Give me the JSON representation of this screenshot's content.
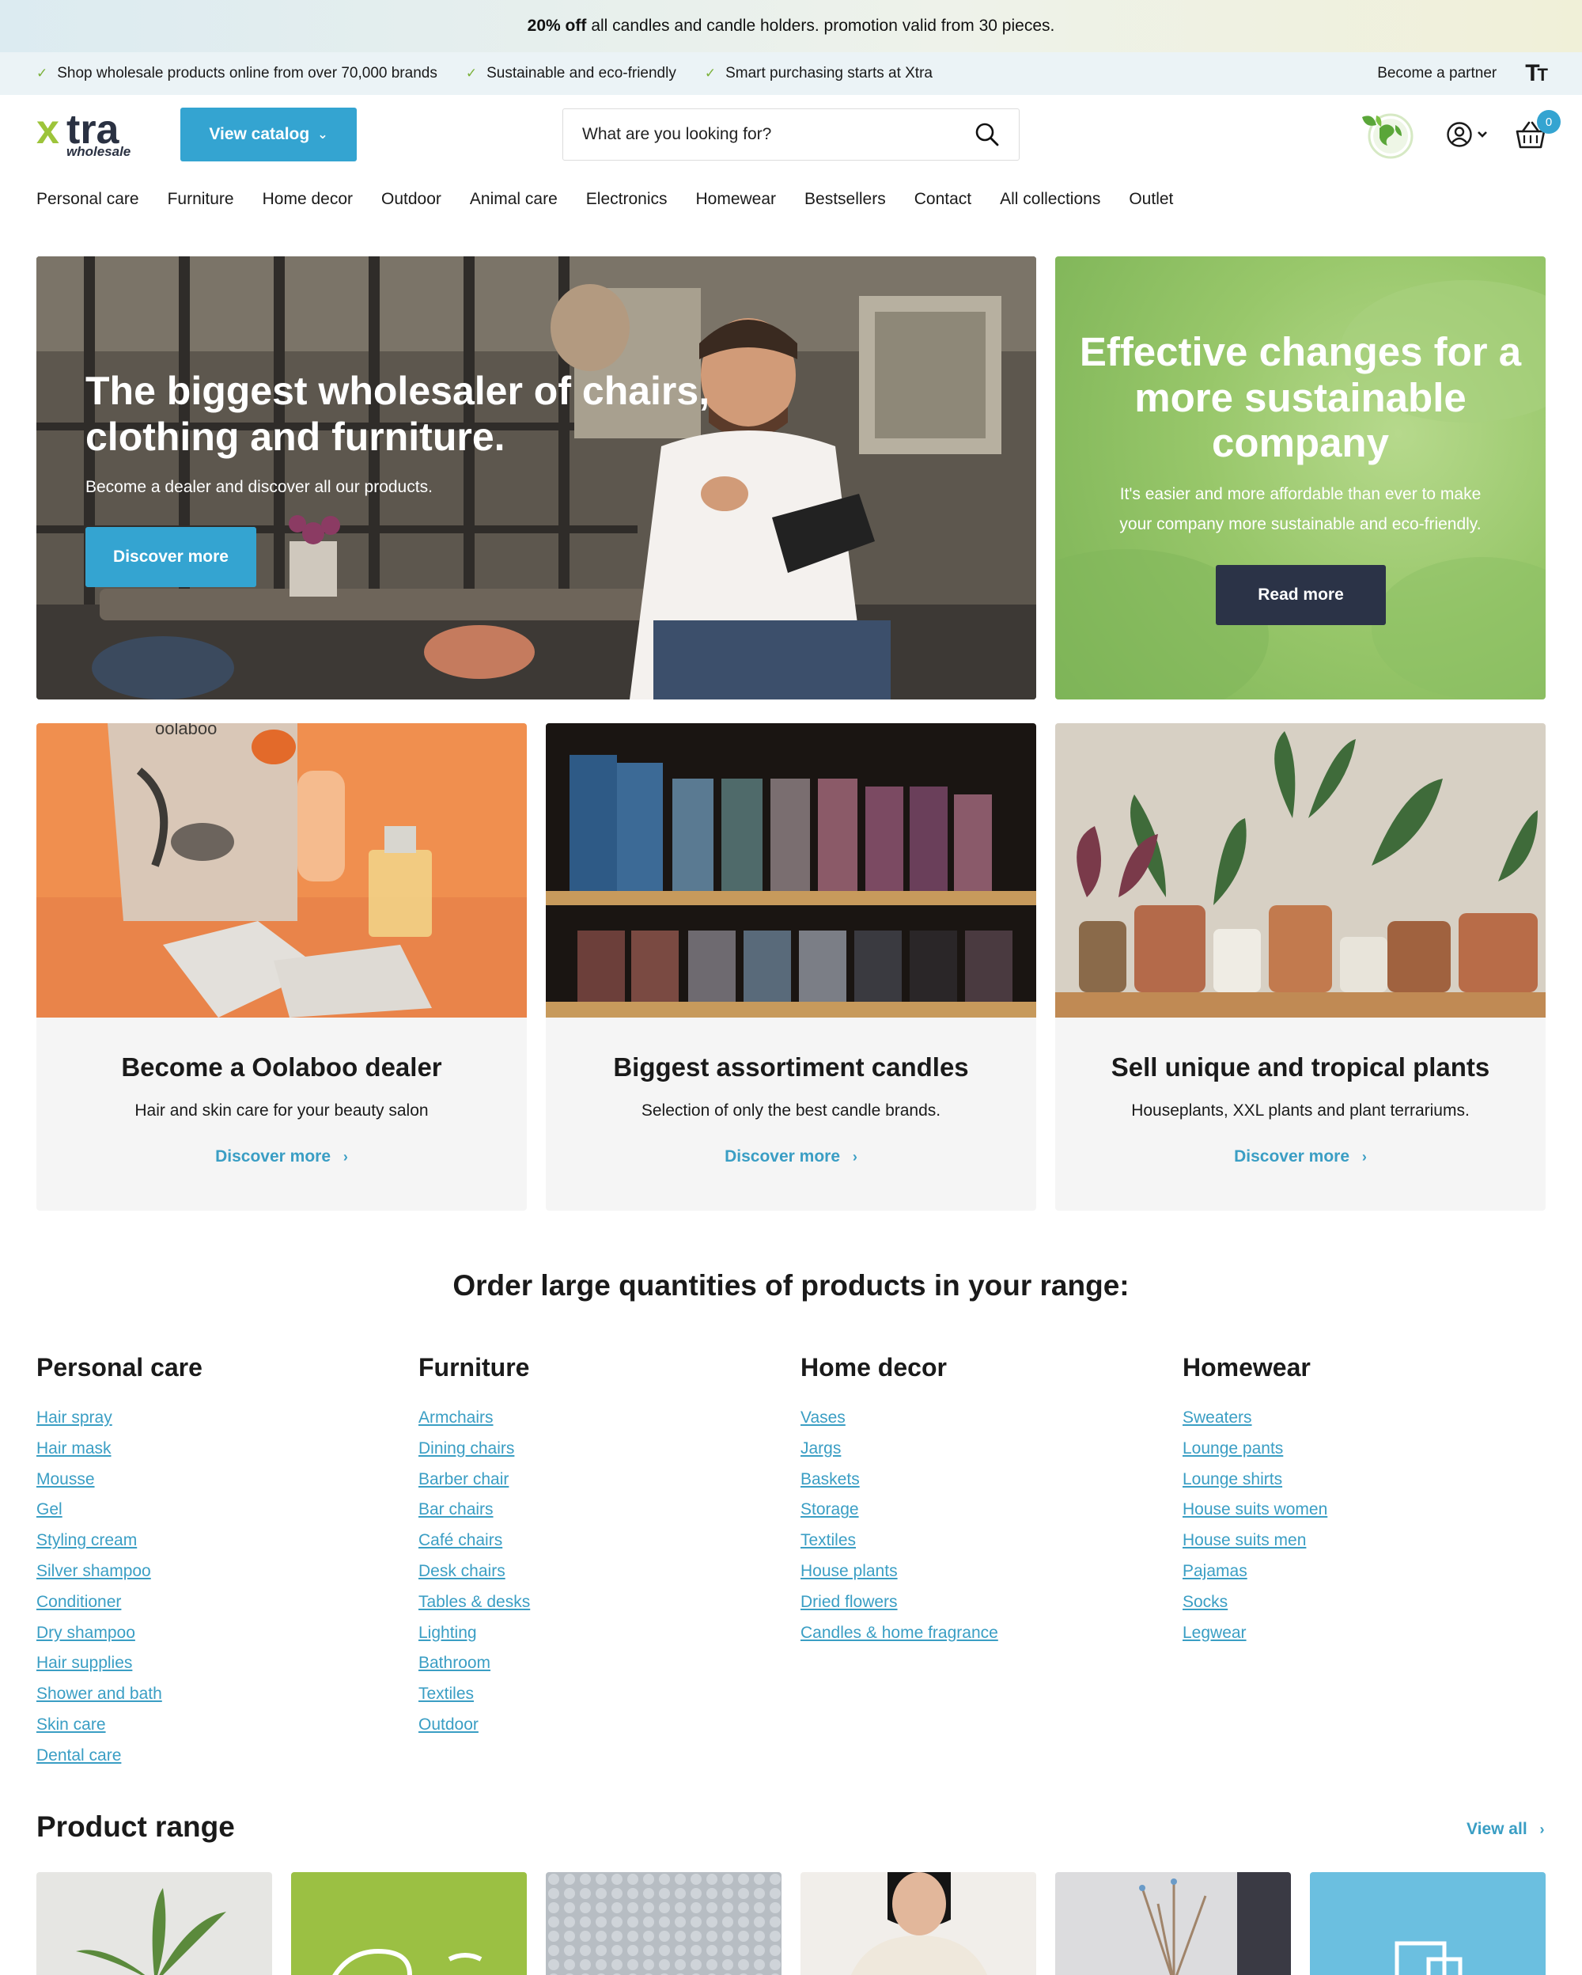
{
  "promo": {
    "bold": "20% off",
    "text": "all candles and candle holders. promotion valid from 30 pieces."
  },
  "usp": {
    "items": [
      "Shop wholesale products online from over 70,000 brands",
      "Sustainable and eco-friendly",
      "Smart purchasing starts at Xtra"
    ],
    "check_icon": "check-icon",
    "partner": "Become a partner",
    "font_size_icon": "Tт"
  },
  "header": {
    "logo_main": "tra",
    "logo_x": "x",
    "logo_sub": "wholesale",
    "catalog_label": "View catalog",
    "search_placeholder": "What are you looking for?",
    "cart_count": "0",
    "accent": "#34a4d1"
  },
  "nav": [
    "Personal care",
    "Furniture",
    "Home decor",
    "Outdoor",
    "Animal care",
    "Electronics",
    "Homewear",
    "Bestsellers",
    "Contact",
    "All collections",
    "Outlet"
  ],
  "hero": {
    "title": "The biggest wholesaler of chairs, clothing and furniture.",
    "subtitle": "Become a dealer and discover all our products.",
    "button": "Discover more"
  },
  "green_banner": {
    "title": "Effective changes for a more sustainable company",
    "subtitle": "It's easier and more affordable than ever to make your company more sustainable and eco-friendly.",
    "button": "Read more"
  },
  "cards": [
    {
      "title": "Become a Oolaboo dealer",
      "subtitle": "Hair and skin care for your beauty salon",
      "link": "Discover more",
      "brand_text": "oolaboo"
    },
    {
      "title": "Biggest assortiment candles",
      "subtitle": "Selection of only the best candle brands.",
      "link": "Discover more"
    },
    {
      "title": "Sell unique and tropical plants",
      "subtitle": "Houseplants, XXL plants and plant terrariums.",
      "link": "Discover more"
    }
  ],
  "range": {
    "title": "Order large quantities of products in your range:",
    "columns": [
      {
        "title": "Personal care",
        "links": [
          "Hair spray",
          "Hair mask",
          "Mousse",
          "Gel",
          "Styling cream",
          "Silver shampoo",
          "Conditioner",
          "Dry shampoo",
          "Hair supplies",
          "Shower and bath",
          "Skin care",
          "Dental care"
        ]
      },
      {
        "title": "Furniture",
        "links": [
          "Armchairs",
          "Dining chairs",
          "Barber chair",
          "Bar chairs",
          "Café chairs",
          "Desk chairs",
          "Tables & desks",
          "Lighting",
          "Bathroom",
          "Textiles",
          "Outdoor"
        ]
      },
      {
        "title": "Home decor",
        "links": [
          "Vases",
          "Jargs",
          "Baskets",
          "Storage",
          "Textiles",
          "House plants",
          "Dried flowers",
          "Candles & home fragrance"
        ]
      },
      {
        "title": "Homewear",
        "links": [
          "Sweaters",
          "Lounge pants",
          "Lounge shirts",
          "House suits women",
          "House suits men",
          "Pajamas",
          "Socks",
          "Legwear"
        ]
      }
    ]
  },
  "product_range": {
    "title": "Product range",
    "view_all": "View all"
  }
}
